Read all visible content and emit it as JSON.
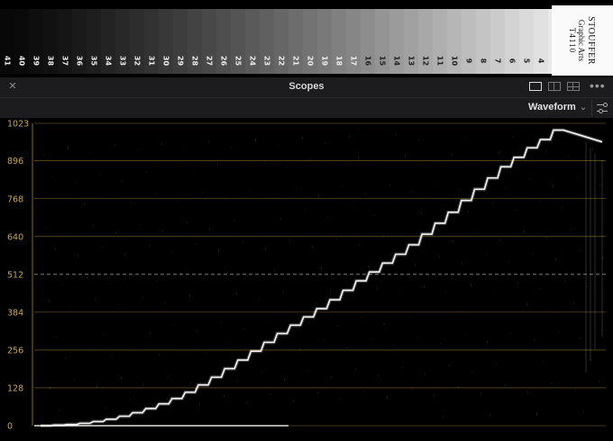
{
  "wedge": {
    "step_labels": [
      "41",
      "40",
      "39",
      "38",
      "37",
      "36",
      "35",
      "34",
      "33",
      "32",
      "31",
      "30",
      "29",
      "28",
      "27",
      "26",
      "25",
      "24",
      "23",
      "22",
      "21",
      "20",
      "19",
      "18",
      "17",
      "16",
      "15",
      "14",
      "13",
      "12",
      "11",
      "10",
      "9",
      "8",
      "7",
      "6",
      "5",
      "4",
      "3",
      "2"
    ],
    "brand_line1": "STOUFFER",
    "brand_line2": "Graphic Arts",
    "brand_line3": "T4110"
  },
  "panel": {
    "title": "Scopes",
    "close_icon": "close-icon",
    "layout_icons": [
      "single-view-icon",
      "dual-view-icon",
      "quad-view-icon"
    ],
    "more_icon": "more-options-icon",
    "scope_mode": "Waveform",
    "settings_icon": "scope-settings-icon"
  },
  "colors": {
    "graticule": "#a8862c",
    "axis_label": "#c9a648",
    "trace": "#ffffff"
  },
  "chart_data": {
    "type": "line",
    "title": "",
    "xlabel": "",
    "ylabel": "",
    "ylim": [
      0,
      1023
    ],
    "y_ticks": [
      "0",
      "128",
      "256",
      "384",
      "512",
      "640",
      "768",
      "896",
      "1023"
    ],
    "dashed_midline": 512,
    "series": [
      {
        "values": [
          0,
          2,
          4,
          8,
          14,
          22,
          32,
          44,
          58,
          74,
          92,
          113,
          138,
          164,
          193,
          222,
          252,
          282,
          312,
          340,
          368,
          396,
          426,
          458,
          490,
          520,
          550,
          580,
          612,
          648,
          685,
          722,
          762,
          800,
          838,
          876,
          908,
          940,
          968,
          1000
        ],
        "tail_start": 990,
        "tail_end": 960
      }
    ]
  }
}
